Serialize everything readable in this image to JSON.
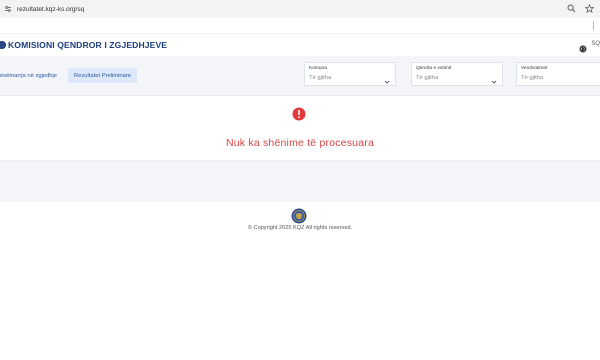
{
  "browser": {
    "url": "rezultatet.kqz-ks.org/sq",
    "icons": [
      "tune-icon",
      "zoom-icon",
      "star-icon"
    ]
  },
  "header": {
    "brand": "KOMISIONI QENDROR I ZGJEDHJEVE",
    "language": "SQ"
  },
  "nav": {
    "home_label": "Pasqyra e zgjedhjeve",
    "home_label_visible": "zgjedhje",
    "home_label_shown": "ësëmarrja në zgjedhje",
    "results_label": "Rezultatet Preliminare"
  },
  "filters": [
    {
      "label": "Komuna",
      "value": "Të gjitha"
    },
    {
      "label": "Qendra e votimit",
      "value": "Të gjitha"
    },
    {
      "label": "Vendvotimet",
      "value": "Të gjitha"
    }
  ],
  "main": {
    "empty_message": "Nuk ka shënime të procesuara"
  },
  "footer": {
    "copyright": "© Copyright 2025 KQZ All rights reserved."
  },
  "colors": {
    "brand": "#1c3e7d",
    "error": "#d64545",
    "band": "#f3f5f9",
    "active_tab": "#dde8f8"
  }
}
